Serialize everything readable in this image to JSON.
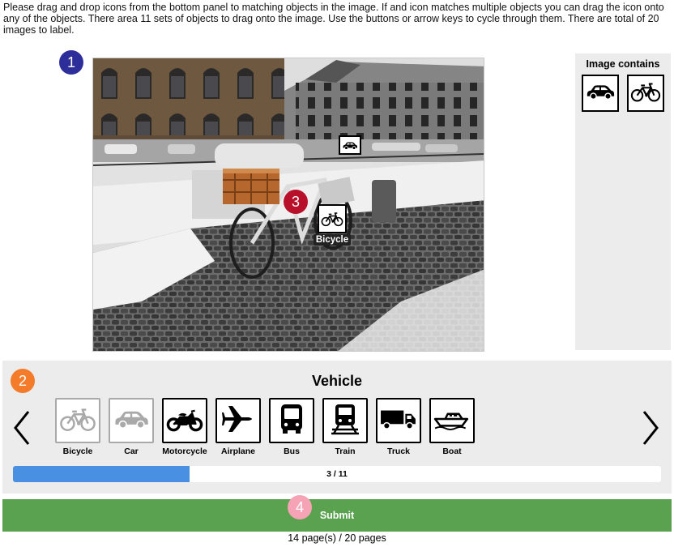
{
  "instructions": "Please drag and drop icons from the bottom panel to matching objects in the image. If and icon matches multiple objects you can drag the icon onto any of the objects. There area 11 sets of objects to drag onto the image. Use the buttons or arrow keys to cycle through them. There are total of 20 images to label.",
  "markers": {
    "m1": "1",
    "m2": "2",
    "m3": "3",
    "m4": "4"
  },
  "marker_colors": {
    "m1": "#2e2e9a",
    "m2": "#f47b2a",
    "m3": "#b8102a",
    "m4": "#f5a3b5"
  },
  "photo": {
    "placed_icon": "car-icon",
    "dragging": {
      "icon": "bicycle-icon",
      "label": "Bicycle"
    }
  },
  "image_contains": {
    "title": "Image contains",
    "items": [
      {
        "icon": "car-icon"
      },
      {
        "icon": "bicycle-icon"
      }
    ]
  },
  "panel": {
    "category": "Vehicle",
    "prev_icon": "chevron-left-icon",
    "next_icon": "chevron-right-icon",
    "icons": [
      {
        "label": "Bicycle",
        "icon": "bicycle-icon",
        "state": "used"
      },
      {
        "label": "Car",
        "icon": "car-icon",
        "state": "used"
      },
      {
        "label": "Motorcycle",
        "icon": "motorcycle-icon",
        "state": "available"
      },
      {
        "label": "Airplane",
        "icon": "airplane-icon",
        "state": "available"
      },
      {
        "label": "Bus",
        "icon": "bus-icon",
        "state": "available"
      },
      {
        "label": "Train",
        "icon": "train-icon",
        "state": "available"
      },
      {
        "label": "Truck",
        "icon": "truck-icon",
        "state": "available"
      },
      {
        "label": "Boat",
        "icon": "boat-icon",
        "state": "available"
      }
    ],
    "progress": {
      "text": "3 / 11",
      "fraction": 0.2727
    }
  },
  "submit_label": "Submit",
  "page_status": "14 page(s) / 20 pages",
  "colors": {
    "progress_fill": "#4a90e2",
    "submit_bg": "#5aa24f",
    "panel_bg": "#ececec"
  }
}
